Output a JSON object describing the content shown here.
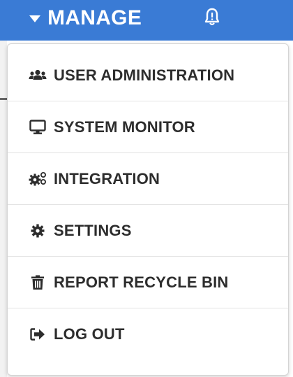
{
  "header": {
    "manage_label": "MANAGE",
    "bell_icon": "bell-alert-icon"
  },
  "menu": {
    "items": [
      {
        "label": "USER ADMINISTRATION",
        "icon": "users-icon"
      },
      {
        "label": "SYSTEM MONITOR",
        "icon": "monitor-icon"
      },
      {
        "label": "INTEGRATION",
        "icon": "gears-icon"
      },
      {
        "label": "SETTINGS",
        "icon": "gear-icon"
      },
      {
        "label": "REPORT RECYCLE BIN",
        "icon": "trash-icon"
      },
      {
        "label": "LOG OUT",
        "icon": "sign-out-icon"
      }
    ]
  },
  "colors": {
    "header_bg": "#3a7bd5",
    "text": "#2d2d2d"
  }
}
